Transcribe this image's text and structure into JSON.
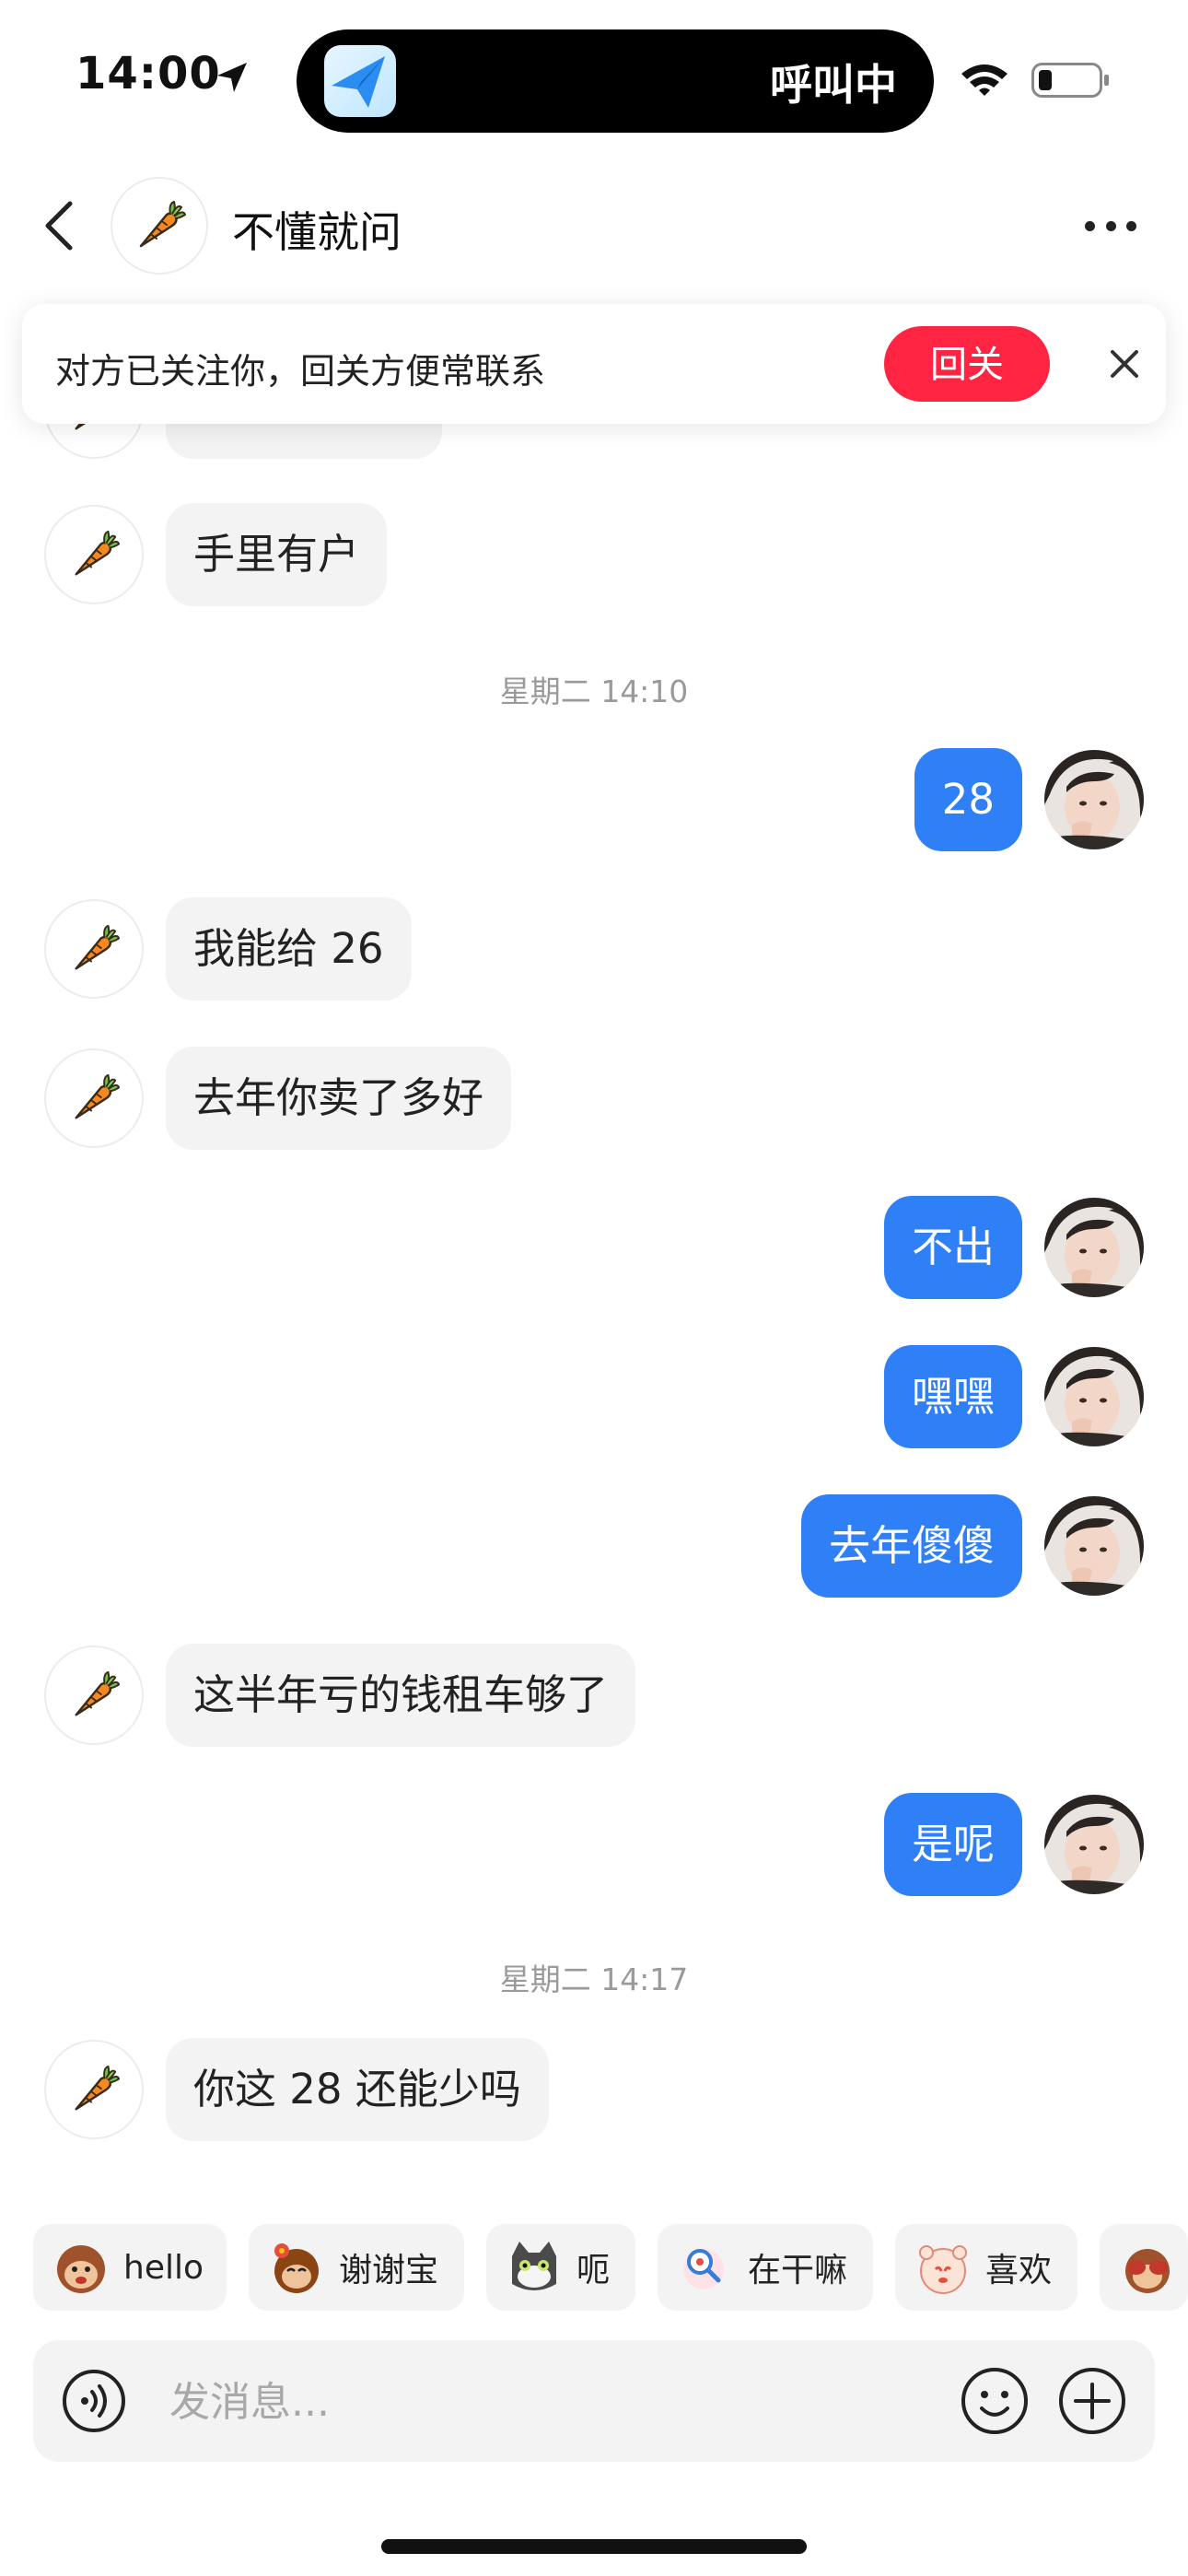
{
  "status_bar": {
    "time": "14:00",
    "call_status": "呼叫中",
    "location_icon": "location-arrow-icon",
    "wifi_icon": "wifi-icon",
    "battery_icon": "battery-low-icon"
  },
  "header": {
    "contact_name": "不懂就问",
    "back_icon": "chevron-left-icon",
    "more_icon": "more-dots-icon",
    "avatar_icon": "carrot-icon"
  },
  "follow_banner": {
    "text": "对方已关注你，回关方便常联系",
    "button_label": "回关",
    "close_icon": "close-icon"
  },
  "messages": [
    {
      "from": "contact",
      "text": "手里有户"
    },
    {
      "type": "timestamp",
      "text": "星期二 14:10"
    },
    {
      "from": "me",
      "text": "28"
    },
    {
      "from": "contact",
      "text": "我能给 26"
    },
    {
      "from": "contact",
      "text": "去年你卖了多好"
    },
    {
      "from": "me",
      "text": "不出"
    },
    {
      "from": "me",
      "text": "嘿嘿"
    },
    {
      "from": "me",
      "text": "去年傻傻"
    },
    {
      "from": "contact",
      "text": "这半年亏的钱租车够了"
    },
    {
      "from": "me",
      "text": "是呢"
    },
    {
      "type": "timestamp",
      "text": "星期二 14:17"
    },
    {
      "from": "contact",
      "text": "你这 28 还能少吗"
    }
  ],
  "quick_replies": [
    {
      "label": "hello",
      "icon": "monkey-sticker-icon"
    },
    {
      "label": "谢谢宝",
      "icon": "flower-monkey-sticker-icon"
    },
    {
      "label": "呃",
      "icon": "cat-sticker-icon"
    },
    {
      "label": "在干嘛",
      "icon": "magnifier-sticker-icon"
    },
    {
      "label": "喜欢",
      "icon": "bear-sticker-icon"
    },
    {
      "label": "",
      "icon": "covering-eyes-sticker-icon"
    }
  ],
  "input_bar": {
    "placeholder": "发消息...",
    "voice_icon": "voice-icon",
    "emoji_icon": "smiley-icon",
    "plus_icon": "plus-circle-icon"
  },
  "colors": {
    "outgoing_bubble": "#2f80f6",
    "incoming_bubble": "#f3f3f3",
    "follow_button": "#ff2442",
    "timestamp_text": "#9a9a9a"
  }
}
